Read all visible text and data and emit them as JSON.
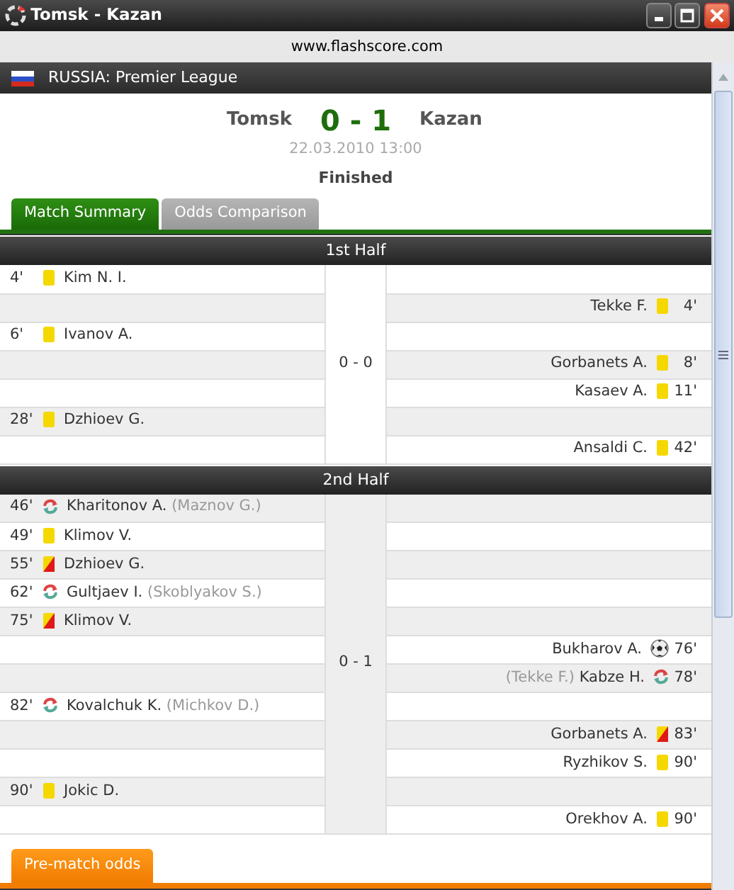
{
  "window": {
    "title": "Tomsk - Kazan"
  },
  "url": "www.flashscore.com",
  "league": {
    "name": "RUSSIA: Premier League"
  },
  "match": {
    "home": "Tomsk",
    "score": "0 - 1",
    "away": "Kazan",
    "date": "22.03.2010 13:00",
    "status": "Finished"
  },
  "tabs": [
    {
      "label": "Match Summary",
      "selected": true
    },
    {
      "label": "Odds Comparison",
      "selected": false
    }
  ],
  "halves": [
    {
      "title": "1st Half",
      "score": "0 - 0",
      "events": [
        {
          "home": {
            "minute": "4'",
            "kind": "yellow",
            "player": "Kim N. I."
          }
        },
        {
          "away": {
            "minute": "4'",
            "kind": "yellow",
            "player": "Tekke F."
          }
        },
        {
          "home": {
            "minute": "6'",
            "kind": "yellow",
            "player": "Ivanov A."
          }
        },
        {
          "away": {
            "minute": "8'",
            "kind": "yellow",
            "player": "Gorbanets A."
          }
        },
        {
          "away": {
            "minute": "11'",
            "kind": "yellow",
            "player": "Kasaev A."
          }
        },
        {
          "home": {
            "minute": "28'",
            "kind": "yellow",
            "player": "Dzhioev G."
          }
        },
        {
          "away": {
            "minute": "42'",
            "kind": "yellow",
            "player": "Ansaldi C."
          }
        }
      ]
    },
    {
      "title": "2nd Half",
      "score": "0 - 1",
      "events": [
        {
          "home": {
            "minute": "46'",
            "kind": "substitution",
            "player": "Kharitonov A.",
            "replaced": "(Maznov G.)"
          }
        },
        {
          "home": {
            "minute": "49'",
            "kind": "yellow",
            "player": "Klimov V."
          }
        },
        {
          "home": {
            "minute": "55'",
            "kind": "second-yellow",
            "player": "Dzhioev G."
          }
        },
        {
          "home": {
            "minute": "62'",
            "kind": "substitution",
            "player": "Gultjaev I.",
            "replaced": "(Skoblyakov S.)"
          }
        },
        {
          "home": {
            "minute": "75'",
            "kind": "second-yellow",
            "player": "Klimov V."
          }
        },
        {
          "away": {
            "minute": "76'",
            "kind": "goal",
            "player": "Bukharov A."
          }
        },
        {
          "away": {
            "minute": "78'",
            "kind": "substitution",
            "player": "Kabze H.",
            "replaced": "(Tekke F.)"
          }
        },
        {
          "home": {
            "minute": "82'",
            "kind": "substitution",
            "player": "Kovalchuk K.",
            "replaced": "(Michkov D.)"
          }
        },
        {
          "away": {
            "minute": "83'",
            "kind": "second-yellow",
            "player": "Gorbanets A."
          }
        },
        {
          "away": {
            "minute": "90'",
            "kind": "yellow",
            "player": "Ryzhikov S."
          }
        },
        {
          "home": {
            "minute": "90'",
            "kind": "yellow",
            "player": "Jokic D."
          }
        },
        {
          "away": {
            "minute": "90'",
            "kind": "yellow",
            "player": "Orekhov A."
          }
        }
      ]
    }
  ],
  "bottom_tabs": [
    {
      "label": "Pre-match odds",
      "selected": true
    }
  ]
}
